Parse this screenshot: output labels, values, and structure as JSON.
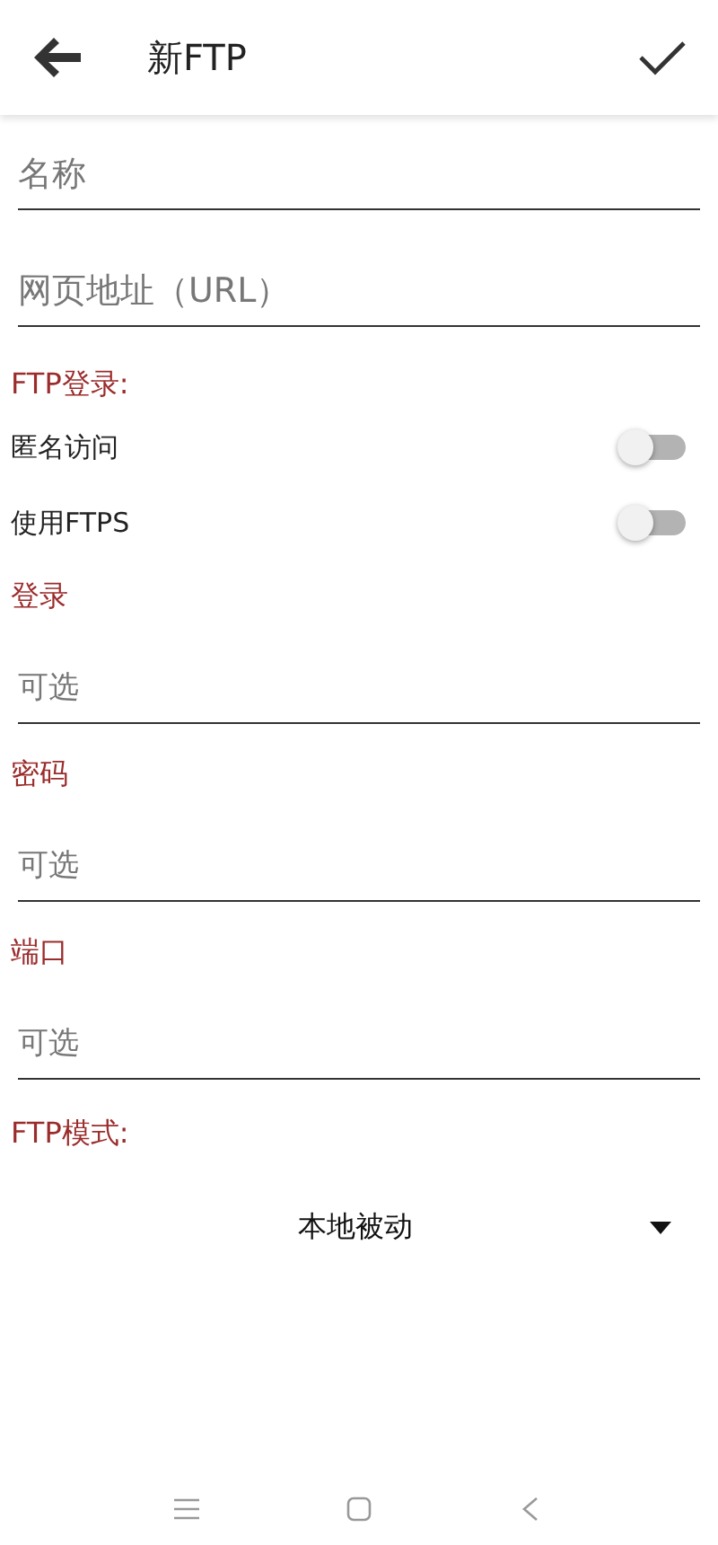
{
  "toolbar": {
    "title": "新FTP"
  },
  "fields": [
    {
      "placeholder": "名称"
    },
    {
      "placeholder": "网页地址（URL）"
    }
  ],
  "login_section": {
    "heading": "FTP登录:",
    "switches": [
      {
        "label": "匿名访问",
        "on": false
      },
      {
        "label": "使用FTPS",
        "on": false
      }
    ],
    "inputs": [
      {
        "label": "登录",
        "placeholder": "可选"
      },
      {
        "label": "密码",
        "placeholder": "可选"
      },
      {
        "label": "端口",
        "placeholder": "可选"
      }
    ]
  },
  "mode_section": {
    "heading": "FTP模式:",
    "dropdown": {
      "value": "本地被动"
    }
  }
}
